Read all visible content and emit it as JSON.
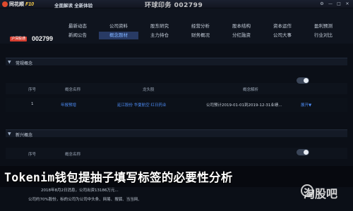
{
  "titlebar": {
    "logo_text": "同花顺",
    "logo_suffix": "F10",
    "subtitle": "全面解读 全新体验",
    "ghost_title": "环球印务 002799"
  },
  "stock": {
    "badge": "沪深股通",
    "code": "002799"
  },
  "nav": {
    "row1": [
      "最新动态",
      "公司资料",
      "股东研究",
      "经营分析",
      "股本结构",
      "资本运作",
      "盈利预测"
    ],
    "row2": [
      "新闻公告",
      "概念题材",
      "主力持仓",
      "财务概况",
      "分红融资",
      "公司大事",
      "行业对比"
    ],
    "active": "概念题材"
  },
  "section1": {
    "title": "常规概念",
    "columns": [
      "序号",
      "概念名称",
      "龙头股",
      "",
      "",
      "概念解析"
    ],
    "row": {
      "index": "1",
      "name": "年报预增",
      "leaders": "延江股份  华夏航空  红日药业",
      "detail": "公司预计2019-01-01到2019-12-31业绩...",
      "expand": "展开"
    }
  },
  "section2": {
    "title": "新兴概念",
    "columns": [
      "序号",
      "概念名称"
    ],
    "news_lines": [
      "2018年8月2日消息，公司出资13186万元...",
      "公司约70%股份，标的公司为公司中头条、网易、搜狐、当当网、"
    ]
  },
  "overlay": {
    "headline": "Tokenim钱包提抽子填写标签的必要性分析",
    "watermark": "淘股吧"
  },
  "colors": {
    "accent_link": "#4d8cf5",
    "active_nav_bg": "#283a64",
    "badge_red": "#d53d2f"
  }
}
